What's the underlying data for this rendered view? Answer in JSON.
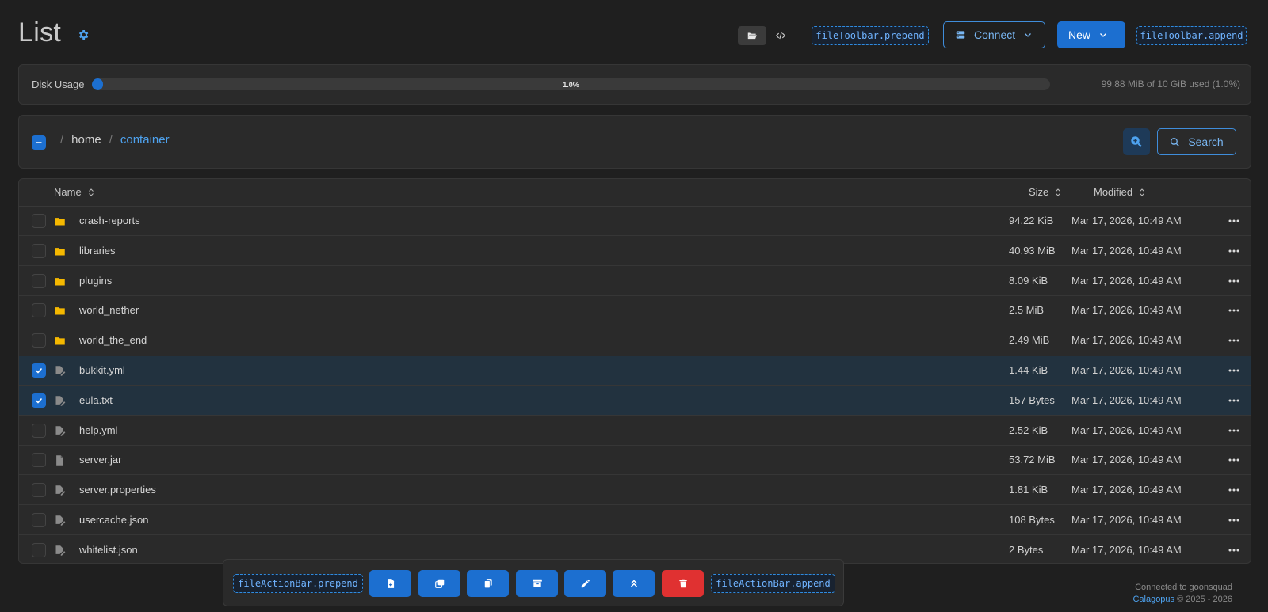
{
  "header": {
    "title": "List",
    "view_modes": [
      "folder-icon",
      "code-icon"
    ],
    "toolbar_prepend": "fileToolbar.prepend",
    "connect_label": "Connect",
    "new_label": "New",
    "toolbar_append": "fileToolbar.append"
  },
  "disk": {
    "label": "Disk Usage",
    "percent_text": "1.0%",
    "fraction": 0.01,
    "usage_text": "99.88 MiB of 10 GiB used (1.0%)"
  },
  "breadcrumb": {
    "separator": "/",
    "items": [
      "home",
      "container"
    ]
  },
  "search": {
    "label": "Search"
  },
  "table": {
    "columns": {
      "name": "Name",
      "size": "Size",
      "modified": "Modified"
    },
    "rows": [
      {
        "name": "crash-reports",
        "type": "folder",
        "size": "94.22 KiB",
        "modified": "Mar 17, 2026, 10:49 AM",
        "selected": false
      },
      {
        "name": "libraries",
        "type": "folder",
        "size": "40.93 MiB",
        "modified": "Mar 17, 2026, 10:49 AM",
        "selected": false
      },
      {
        "name": "plugins",
        "type": "folder",
        "size": "8.09 KiB",
        "modified": "Mar 17, 2026, 10:49 AM",
        "selected": false
      },
      {
        "name": "world_nether",
        "type": "folder",
        "size": "2.5 MiB",
        "modified": "Mar 17, 2026, 10:49 AM",
        "selected": false
      },
      {
        "name": "world_the_end",
        "type": "folder",
        "size": "2.49 MiB",
        "modified": "Mar 17, 2026, 10:49 AM",
        "selected": false
      },
      {
        "name": "bukkit.yml",
        "type": "editable",
        "size": "1.44 KiB",
        "modified": "Mar 17, 2026, 10:49 AM",
        "selected": true
      },
      {
        "name": "eula.txt",
        "type": "editable",
        "size": "157 Bytes",
        "modified": "Mar 17, 2026, 10:49 AM",
        "selected": true
      },
      {
        "name": "help.yml",
        "type": "editable",
        "size": "2.52 KiB",
        "modified": "Mar 17, 2026, 10:49 AM",
        "selected": false
      },
      {
        "name": "server.jar",
        "type": "file",
        "size": "53.72 MiB",
        "modified": "Mar 17, 2026, 10:49 AM",
        "selected": false
      },
      {
        "name": "server.properties",
        "type": "editable",
        "size": "1.81 KiB",
        "modified": "Mar 17, 2026, 10:49 AM",
        "selected": false
      },
      {
        "name": "usercache.json",
        "type": "editable",
        "size": "108 Bytes",
        "modified": "Mar 17, 2026, 10:49 AM",
        "selected": false
      },
      {
        "name": "whitelist.json",
        "type": "editable",
        "size": "2 Bytes",
        "modified": "Mar 17, 2026, 10:49 AM",
        "selected": false
      }
    ]
  },
  "action_bar": {
    "prepend": "fileActionBar.prepend",
    "append": "fileActionBar.append",
    "buttons": [
      "download-file-icon",
      "copy-icon",
      "duplicate-icon",
      "archive-icon",
      "rename-icon",
      "move-up-icon",
      "delete-icon"
    ]
  },
  "footer": {
    "connected": "Connected to goonsquad",
    "brand": "Calagopus",
    "copyright": "© 2025 - 2026"
  },
  "colors": {
    "accent": "#1c6fd0",
    "danger": "#e03131",
    "folder": "#f5b800",
    "background": "#1f1f1f"
  }
}
